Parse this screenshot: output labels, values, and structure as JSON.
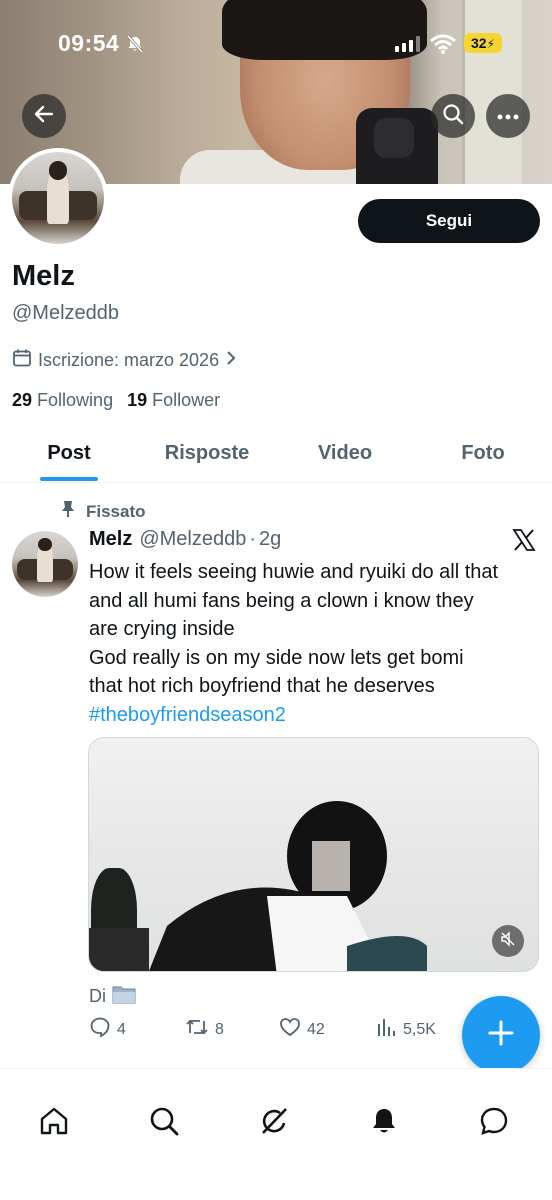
{
  "status_bar": {
    "time": "09:54",
    "battery": "32"
  },
  "header": {
    "back_icon": "arrow-left-icon",
    "search_icon": "search-icon",
    "more_icon": "more-icon"
  },
  "profile": {
    "follow_label": "Segui",
    "name": "Melz",
    "handle": "@Melzeddb",
    "joined": "Iscrizione: marzo 2026",
    "following_count": "29",
    "following_label": "Following",
    "follower_count": "19",
    "follower_label": "Follower"
  },
  "tabs": [
    {
      "label": "Post",
      "active": true
    },
    {
      "label": "Risposte",
      "active": false
    },
    {
      "label": "Video",
      "active": false
    },
    {
      "label": "Foto",
      "active": false
    }
  ],
  "pinned_post": {
    "pinned_label": "Fissato",
    "author_name": "Melz",
    "author_handle": "@Melzeddb",
    "separator": "·",
    "time": "2g",
    "text_lines": [
      "How it feels seeing huwie and ryuiki do all that",
      "and all humi fans being a clown i know they",
      "are crying inside",
      "God really is on my side now lets get bomi",
      "that hot rich boyfriend that he deserves"
    ],
    "hashtag": "#theboyfriendseason2",
    "source_label": "Di",
    "replies": "4",
    "reposts": "8",
    "likes": "42",
    "views": "5,5K"
  },
  "colors": {
    "accent": "#1d9bf0",
    "text": "#0f1419",
    "muted": "#536471"
  },
  "bottom_nav": [
    "home-icon",
    "search-icon",
    "grok-icon",
    "notifications-icon",
    "messages-icon"
  ]
}
